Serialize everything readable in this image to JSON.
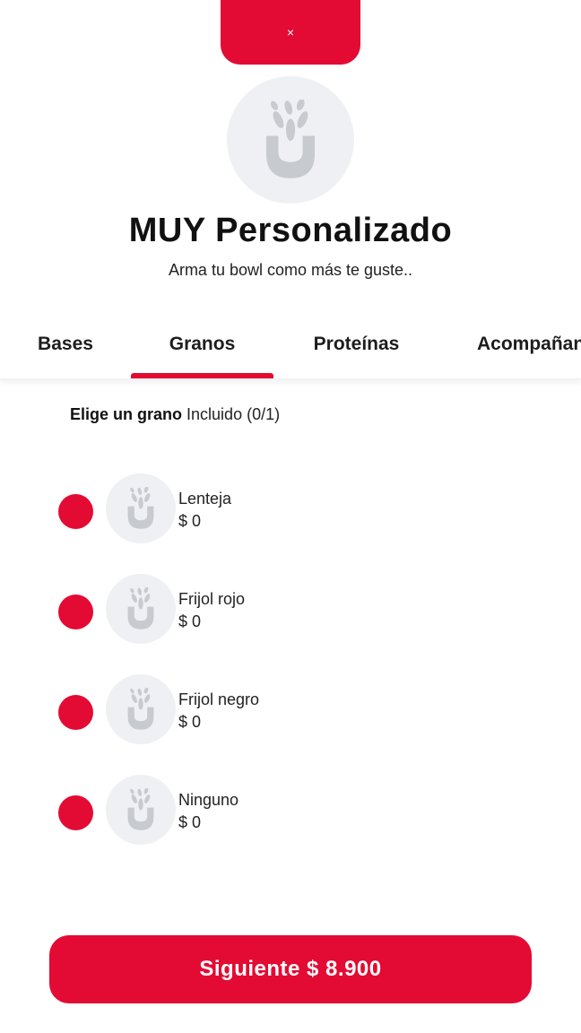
{
  "modal": {
    "close_label": "×"
  },
  "header": {
    "title": "MUY Personalizado",
    "subtitle": "Arma tu bowl como más te guste.."
  },
  "tabs": [
    {
      "label": "Bases",
      "active": false
    },
    {
      "label": "Granos",
      "active": true
    },
    {
      "label": "Proteínas",
      "active": false
    },
    {
      "label": "Acompañantes",
      "active": false
    }
  ],
  "section": {
    "heading": "Elige un grano",
    "note": "Incluido (0/1)"
  },
  "options": [
    {
      "name": "Lenteja",
      "price": "$ 0"
    },
    {
      "name": "Frijol rojo",
      "price": "$ 0"
    },
    {
      "name": "Frijol negro",
      "price": "$ 0"
    },
    {
      "name": "Ninguno",
      "price": "$ 0"
    }
  ],
  "footer": {
    "cta_label": "Siguiente $ 8.900"
  },
  "colors": {
    "accent": "#e30b33",
    "placeholder_bg": "#eef0f4",
    "icon_gray": "#c7cacf"
  },
  "icons": {
    "placeholder": "bowl-sprout-icon"
  }
}
